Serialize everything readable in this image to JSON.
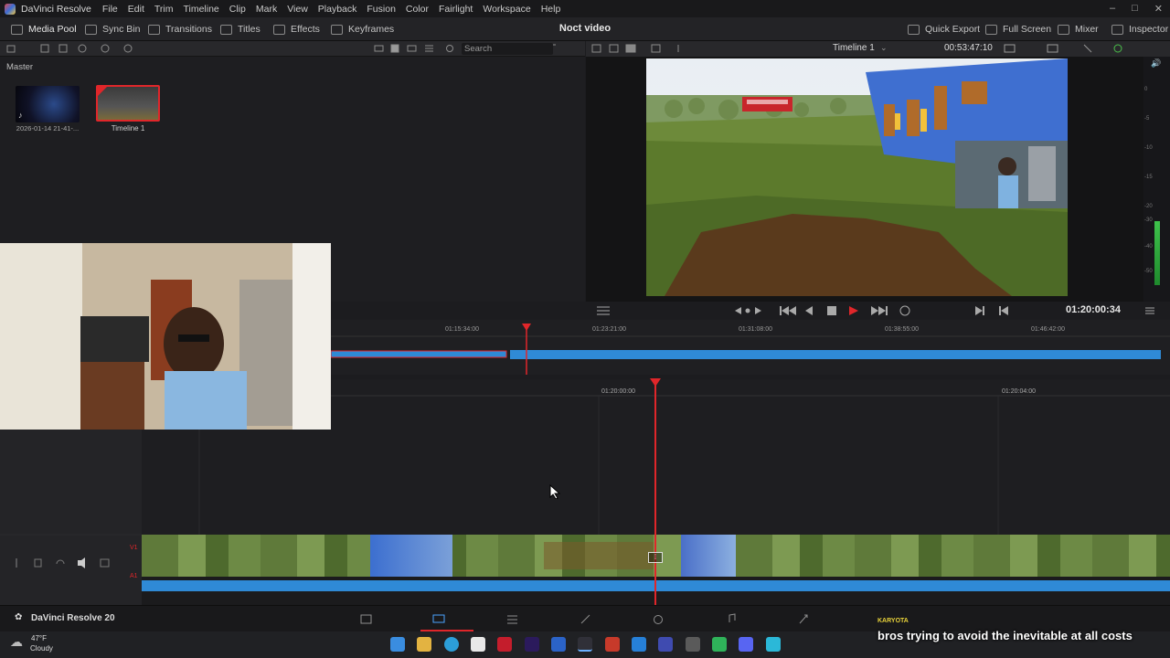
{
  "app": {
    "name": "DaVinci Resolve",
    "version_label": "DaVinci Resolve 20"
  },
  "menu": [
    "File",
    "Edit",
    "Trim",
    "Timeline",
    "Clip",
    "Mark",
    "View",
    "Playback",
    "Fusion",
    "Color",
    "Fairlight",
    "Workspace",
    "Help"
  ],
  "toolbar": {
    "left": [
      {
        "label": "Media Pool",
        "icon": "media-pool-icon"
      },
      {
        "label": "Sync Bin",
        "icon": "sync-bin-icon"
      },
      {
        "label": "Transitions",
        "icon": "transitions-icon"
      },
      {
        "label": "Titles",
        "icon": "titles-icon"
      },
      {
        "label": "Effects",
        "icon": "effects-icon"
      },
      {
        "label": "Keyframes",
        "icon": "keyframes-icon"
      }
    ],
    "project_title": "Noct video",
    "right": [
      {
        "label": "Quick Export",
        "icon": "export-icon"
      },
      {
        "label": "Full Screen",
        "icon": "fullscreen-icon"
      },
      {
        "label": "Mixer",
        "icon": "mixer-icon"
      },
      {
        "label": "Inspector",
        "icon": "inspector-icon"
      }
    ]
  },
  "media_pool": {
    "bin_label": "Master",
    "search_placeholder": "Search",
    "clips": [
      {
        "name": "2026-01-14 21-41-..."
      },
      {
        "name": "Timeline 1"
      }
    ]
  },
  "viewer": {
    "timeline_name": "Timeline 1",
    "duration": "00:53:47:10",
    "timecode": "01:20:00:34"
  },
  "timeline": {
    "upper_ruler": [
      "01:15:34:00",
      "01:23:21:00",
      "01:31:08:00",
      "01:38:55:00",
      "01:46:42:00"
    ],
    "lower_ruler": [
      "01:20:00:00",
      "01:20:04:00"
    ],
    "tracks": [
      "V1",
      "A1"
    ]
  },
  "meter_scale": [
    "0",
    "-5",
    "-10",
    "-15",
    "-20",
    "-30",
    "-40",
    "-50"
  ],
  "overlay": {
    "streamer": "KARYOTA",
    "subtitle": "bros trying to avoid the inevitable at all costs"
  },
  "weather": {
    "temp": "47°F",
    "condition": "Cloudy"
  },
  "colors": {
    "accent_red": "#e0262a",
    "clip_blue": "#2f8ad6",
    "panel": "#1e1e21"
  }
}
